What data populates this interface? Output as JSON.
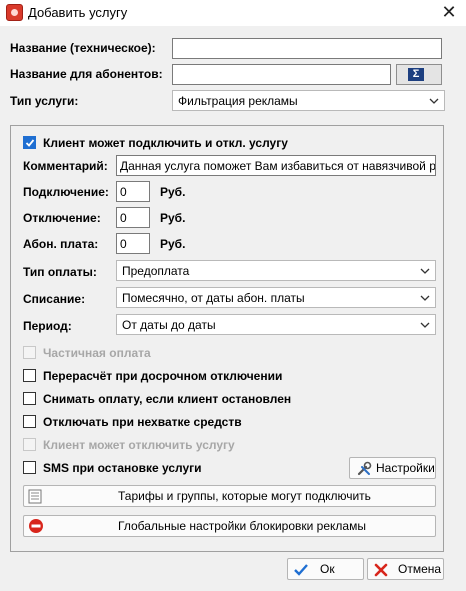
{
  "window": {
    "title": "Добавить услугу",
    "close_symbol": "✕"
  },
  "fields": {
    "tech_name_label": "Название (техническое):",
    "tech_name_value": "",
    "sub_name_label": "Название для абонентов:",
    "sub_name_value": "",
    "sigma_symbol": "Σ",
    "service_type_label": "Тип услуги:",
    "service_type_value": "Фильтрация рекламы"
  },
  "group": {
    "client_can_toggle": {
      "label": "Клиент может подключить и откл. услугу",
      "checked": true
    },
    "comment_label": "Комментарий:",
    "comment_value": "Данная услуга поможет Вам избавиться от навязчивой рекламы",
    "connect_label": "Подключение:",
    "connect_value": "0",
    "disconnect_label": "Отключение:",
    "disconnect_value": "0",
    "fee_label": "Абон. плата:",
    "fee_value": "0",
    "currency": "Руб.",
    "payment_type_label": "Тип оплаты:",
    "payment_type_value": "Предоплата",
    "writeoff_label": "Списание:",
    "writeoff_value": "Помесячно, от даты абон. платы",
    "period_label": "Период:",
    "period_value": "От даты до даты",
    "partial_payment": {
      "label": "Частичная оплата",
      "checked": false,
      "enabled": false
    },
    "recalc_early": {
      "label": "Перерасчёт при досрочном отключении",
      "checked": false,
      "enabled": true
    },
    "charge_if_stopped": {
      "label": "Снимать оплату, если клиент остановлен",
      "checked": false,
      "enabled": true
    },
    "disable_no_funds": {
      "label": "Отключать при нехватке средств",
      "checked": false,
      "enabled": true
    },
    "client_can_disable": {
      "label": "Клиент может отключить услугу",
      "checked": false,
      "enabled": false
    },
    "sms_on_stop": {
      "label": "SMS при остановке услуги",
      "checked": false,
      "enabled": true
    },
    "settings_button": "Настройки",
    "tariffs_button": "Тарифы и группы, которые могут подключить",
    "global_settings_button": "Глобальные настройки блокировки рекламы"
  },
  "footer": {
    "ok": "Ок",
    "cancel": "Отмена"
  }
}
